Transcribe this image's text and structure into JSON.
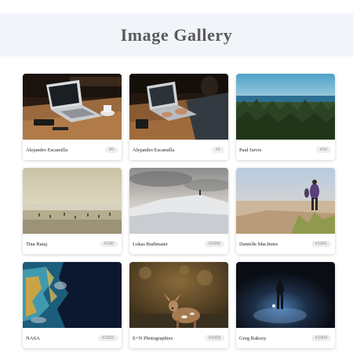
{
  "header": {
    "title": "Image Gallery"
  },
  "photos": [
    {
      "author": "Alejandro Escamilla",
      "id": "#0"
    },
    {
      "author": "Alejandro Escamilla",
      "id": "#1"
    },
    {
      "author": "Paul Jarvis",
      "id": "#10"
    },
    {
      "author": "Tina Rataj",
      "id": "#100"
    },
    {
      "author": "Lukas Budimaier",
      "id": "#1000"
    },
    {
      "author": "Danielle MacInnes",
      "id": "#1001"
    },
    {
      "author": "NASA",
      "id": "#1002"
    },
    {
      "author": "E+N Photographies",
      "id": "#1003"
    },
    {
      "author": "Greg Rakozy",
      "id": "#1004"
    }
  ]
}
